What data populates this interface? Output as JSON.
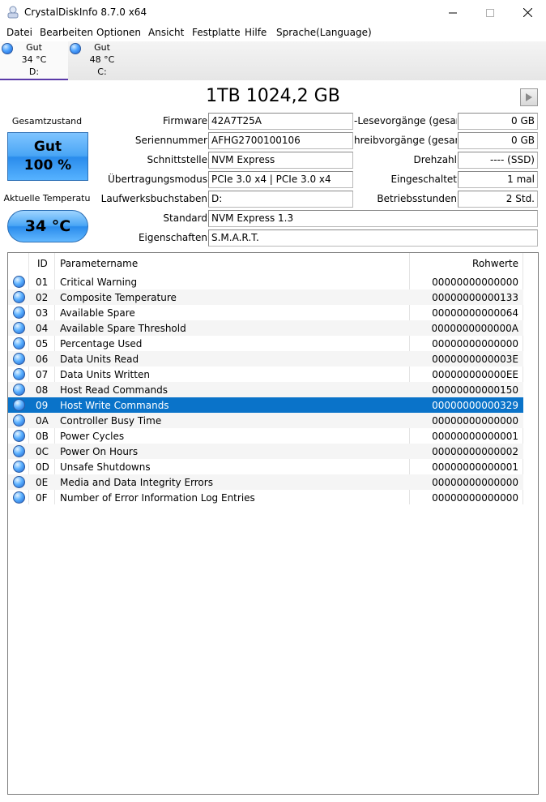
{
  "window": {
    "title": "CrystalDiskInfo 8.7.0 x64"
  },
  "menu": [
    "Datei",
    "Bearbeiten",
    "Optionen",
    "Ansicht",
    "Festplatte",
    "Hilfe",
    "Sprache(Language)"
  ],
  "drives": [
    {
      "status": "Gut",
      "temp": "34 °C",
      "letter": "D:",
      "active": true
    },
    {
      "status": "Gut",
      "temp": "48 °C",
      "letter": "C:",
      "active": false
    }
  ],
  "disk": {
    "size": "1TB 1024,2 GB"
  },
  "health": {
    "label": "Gesamtzustand",
    "status": "Gut",
    "percent": "100 %",
    "temp_label": "Aktuelle Temperatu",
    "temp": "34 °C",
    "color": "#4aa6f5"
  },
  "info": {
    "firmware_label": "Firmware",
    "firmware": "42A7T25A",
    "serial_label": "Seriennummer",
    "serial": "AFHG2700100106",
    "interface_label": "Schnittstelle",
    "interface": "NVM Express",
    "transfer_label": "Übertragungsmodus",
    "transfer": "PCIe 3.0 x4 | PCIe 3.0 x4",
    "letters_label": "Laufwerksbuchstaben",
    "letters": "D:",
    "standard_label": "Standard",
    "standard": "NVM Express 1.3",
    "features_label": "Eigenschaften",
    "features": "S.M.A.R.T.",
    "reads_label": "-Lesevorgänge (gesamt)",
    "reads": "0 GB",
    "writes_label": "hreibvorgänge (gesamt)",
    "writes": "0 GB",
    "rpm_label": "Drehzahl",
    "rpm": "---- (SSD)",
    "poweron_count_label": "Eingeschaltet",
    "poweron_count": "1 mal",
    "poweron_hours_label": "Betriebsstunden",
    "poweron_hours": "2 Std."
  },
  "smart": {
    "headers": {
      "id": "ID",
      "name": "Parametername",
      "raw": "Rohwerte"
    },
    "selected_color": "#0a73c9",
    "rows": [
      {
        "id": "01",
        "name": "Critical Warning",
        "raw": "00000000000000"
      },
      {
        "id": "02",
        "name": "Composite Temperature",
        "raw": "00000000000133"
      },
      {
        "id": "03",
        "name": "Available Spare",
        "raw": "00000000000064"
      },
      {
        "id": "04",
        "name": "Available Spare Threshold",
        "raw": "0000000000000A"
      },
      {
        "id": "05",
        "name": "Percentage Used",
        "raw": "00000000000000"
      },
      {
        "id": "06",
        "name": "Data Units Read",
        "raw": "0000000000003E"
      },
      {
        "id": "07",
        "name": "Data Units Written",
        "raw": "000000000000EE"
      },
      {
        "id": "08",
        "name": "Host Read Commands",
        "raw": "00000000000150"
      },
      {
        "id": "09",
        "name": "Host Write Commands",
        "raw": "00000000000329",
        "selected": true
      },
      {
        "id": "0A",
        "name": "Controller Busy Time",
        "raw": "00000000000000"
      },
      {
        "id": "0B",
        "name": "Power Cycles",
        "raw": "00000000000001"
      },
      {
        "id": "0C",
        "name": "Power On Hours",
        "raw": "00000000000002"
      },
      {
        "id": "0D",
        "name": "Unsafe Shutdowns",
        "raw": "00000000000001"
      },
      {
        "id": "0E",
        "name": "Media and Data Integrity Errors",
        "raw": "00000000000000"
      },
      {
        "id": "0F",
        "name": "Number of Error Information Log Entries",
        "raw": "00000000000000"
      }
    ]
  }
}
